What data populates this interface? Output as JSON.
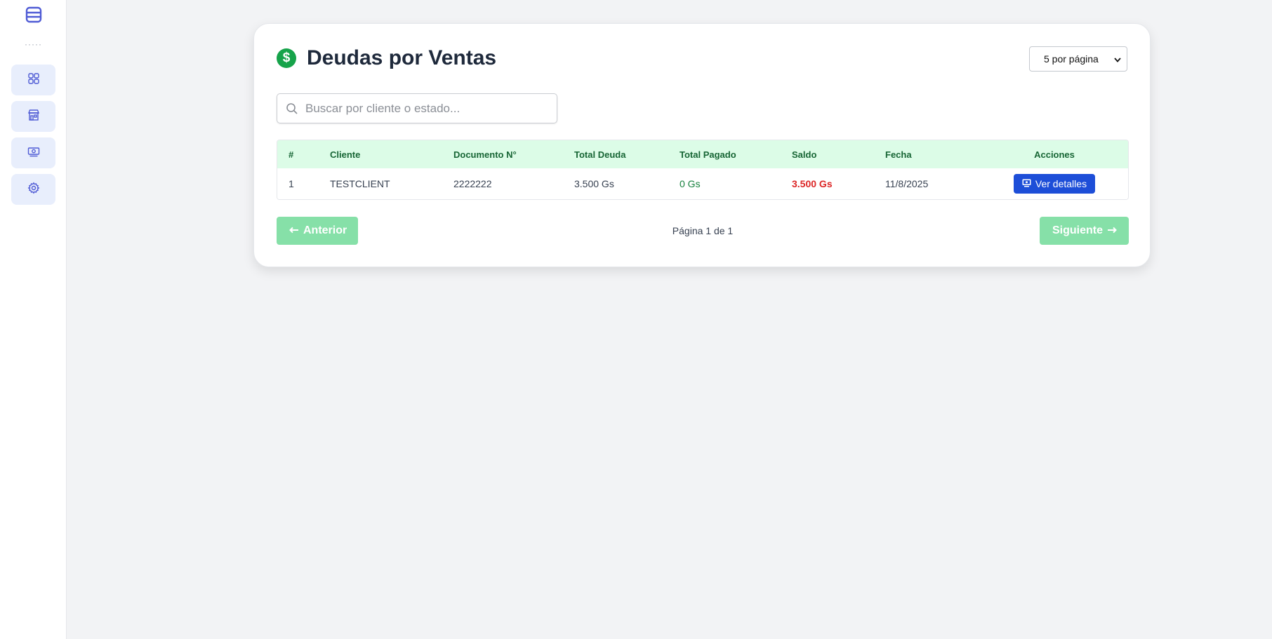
{
  "colors": {
    "accent": "#4f5bd5",
    "brand_green": "#16a34a",
    "header_bg": "#dcfce7",
    "header_text": "#166534",
    "saldo_red": "#dc2626",
    "details_blue": "#1d4ed8",
    "pager_disabled": "#86e0a8"
  },
  "sidebar": {
    "menu_icon": "hamburger-menu-icon",
    "divider": "·····",
    "items": [
      {
        "icon": "grid-icon",
        "name": "dashboard"
      },
      {
        "icon": "store-icon",
        "name": "store"
      },
      {
        "icon": "money-icon",
        "name": "sales-debts"
      },
      {
        "icon": "gear-icon",
        "name": "settings"
      }
    ]
  },
  "page": {
    "title_icon": "dollar-circle-icon",
    "title": "Deudas por Ventas",
    "per_page": "5 por página",
    "search_placeholder": "Buscar por cliente o estado..."
  },
  "table": {
    "headers": [
      "#",
      "Cliente",
      "Documento N°",
      "Total Deuda",
      "Total Pagado",
      "Saldo",
      "Fecha",
      "Acciones"
    ],
    "rows": [
      {
        "num": "1",
        "cliente": "TESTCLIENT",
        "documento": "2222222",
        "total_deuda": "3.500 Gs",
        "total_pagado": "0 Gs",
        "saldo": "3.500 Gs",
        "fecha": "11/8/2025",
        "action_label": "Ver detalles",
        "action_icon": "monitor-icon"
      }
    ]
  },
  "pagination": {
    "prev_label": "Anterior",
    "prev_icon": "arrow-left-icon",
    "page_label": "Página 1 de 1",
    "next_label": "Siguiente",
    "next_icon": "arrow-right-icon"
  }
}
